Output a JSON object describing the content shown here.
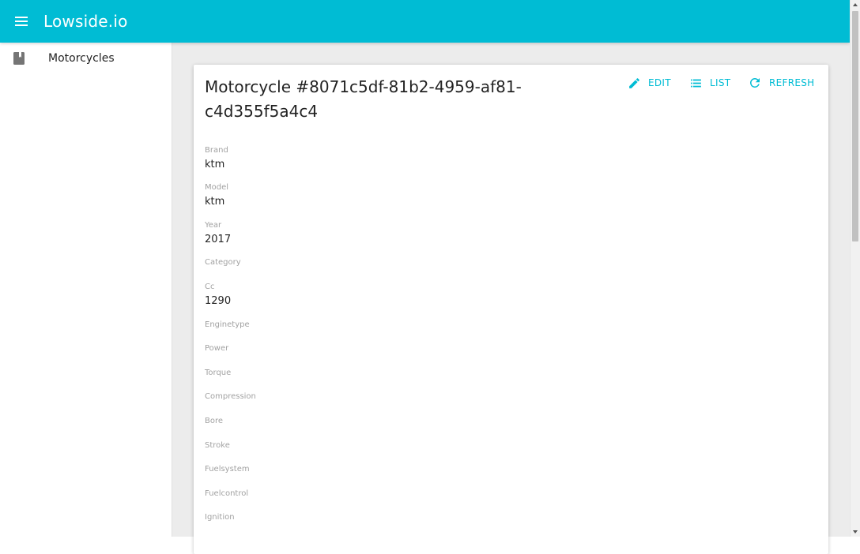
{
  "app": {
    "title": "Lowside.io",
    "menu_icon": "menu-icon"
  },
  "sidebar": {
    "items": [
      {
        "label": "Motorcycles",
        "icon": "book-icon"
      }
    ]
  },
  "colors": {
    "primary": "#00bcd4",
    "background": "#ececec"
  },
  "record": {
    "title": "Motorcycle #8071c5df-81b2-4959-af81-c4d355f5a4c4",
    "actions": {
      "edit": {
        "label": "EDIT",
        "icon": "pencil-icon"
      },
      "list": {
        "label": "LIST",
        "icon": "list-icon"
      },
      "refresh": {
        "label": "REFRESH",
        "icon": "refresh-icon"
      }
    },
    "fields": {
      "brand": {
        "label": "Brand",
        "value": "ktm"
      },
      "model": {
        "label": "Model",
        "value": "ktm"
      },
      "year": {
        "label": "Year",
        "value": "2017"
      },
      "category": {
        "label": "Category",
        "value": ""
      },
      "cc": {
        "label": "Cc",
        "value": "1290"
      },
      "enginetype": {
        "label": "Enginetype",
        "value": ""
      },
      "power": {
        "label": "Power",
        "value": ""
      },
      "torque": {
        "label": "Torque",
        "value": ""
      },
      "compression": {
        "label": "Compression",
        "value": ""
      },
      "bore": {
        "label": "Bore",
        "value": ""
      },
      "stroke": {
        "label": "Stroke",
        "value": ""
      },
      "fuelsystem": {
        "label": "Fuelsystem",
        "value": ""
      },
      "fuelcontrol": {
        "label": "Fuelcontrol",
        "value": ""
      },
      "ignition": {
        "label": "Ignition",
        "value": ""
      }
    }
  }
}
